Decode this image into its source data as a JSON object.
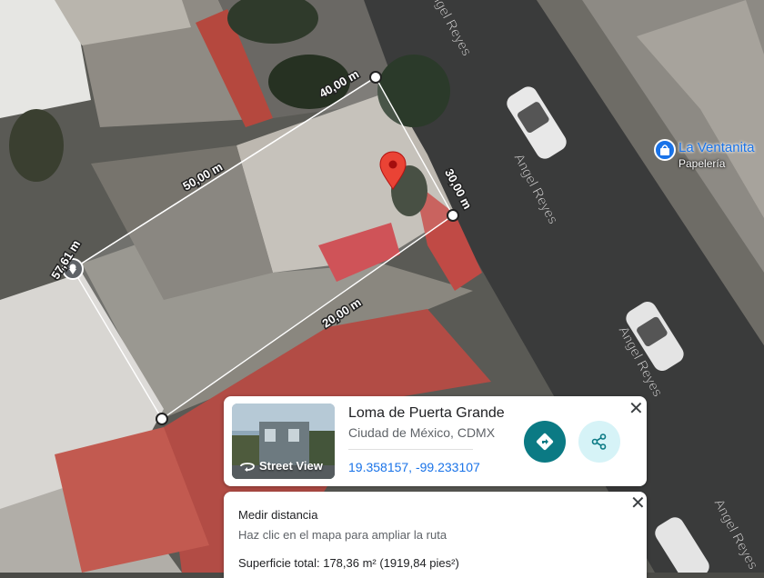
{
  "map": {
    "street_labels": [
      "Angel Reyes",
      "Angel Reyes",
      "Angel Reyes",
      "Angel Reyes"
    ],
    "measurements": [
      "40,00 m",
      "50,00 m",
      "30,00 m",
      "20,00 m",
      "57,61 m"
    ],
    "poi": {
      "name": "La Ventanita",
      "category": "Papelería",
      "icon": "shopping-bag-icon",
      "color": "#1a73e8"
    },
    "pin_color": "#ea4335"
  },
  "place_card": {
    "title": "Loma de Puerta Grande",
    "subtitle": "Ciudad de México, CDMX",
    "coordinates": "19.358157, -99.233107",
    "street_view_label": "Street View",
    "close": "✕",
    "accent": "#0b7a84"
  },
  "measure_card": {
    "title": "Medir distancia",
    "hint": "Haz clic en el mapa para ampliar la ruta",
    "area": "Superficie total: 178,36 m² (1919,84 pies²)",
    "close": "✕"
  }
}
